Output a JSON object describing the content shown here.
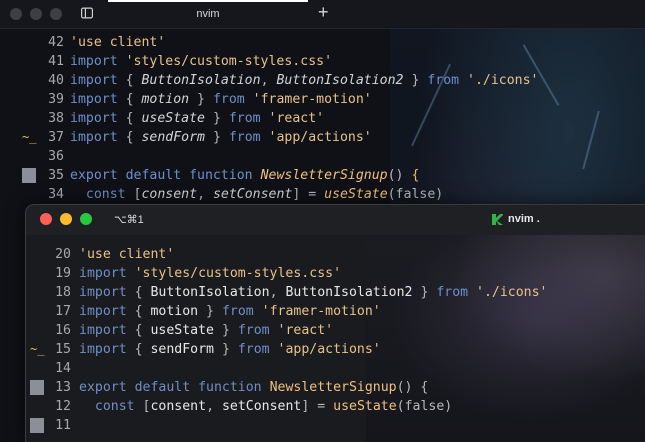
{
  "back_window": {
    "tab_label": "nvim",
    "lines": [
      {
        "num": "42",
        "gutter": "",
        "segments": [
          [
            "str",
            "'use client'"
          ]
        ]
      },
      {
        "num": "41",
        "gutter": "",
        "segments": [
          [
            "kw",
            "import "
          ],
          [
            "str",
            "'styles/custom-styles.css'"
          ]
        ]
      },
      {
        "num": "40",
        "gutter": "",
        "segments": [
          [
            "kw",
            "import "
          ],
          [
            "pun",
            "{ "
          ],
          [
            "id it",
            "ButtonIsolation"
          ],
          [
            "pun",
            ", "
          ],
          [
            "id it",
            "ButtonIsolation2"
          ],
          [
            "pun",
            " } "
          ],
          [
            "kw",
            "from "
          ],
          [
            "str",
            "'./icons'"
          ]
        ]
      },
      {
        "num": "39",
        "gutter": "",
        "segments": [
          [
            "kw",
            "import "
          ],
          [
            "pun",
            "{ "
          ],
          [
            "id it",
            "motion"
          ],
          [
            "pun",
            " } "
          ],
          [
            "kw",
            "from "
          ],
          [
            "str",
            "'framer-motion'"
          ]
        ]
      },
      {
        "num": "38",
        "gutter": "",
        "segments": [
          [
            "kw",
            "import "
          ],
          [
            "pun",
            "{ "
          ],
          [
            "id it",
            "useState"
          ],
          [
            "pun",
            " } "
          ],
          [
            "kw",
            "from "
          ],
          [
            "str",
            "'react'"
          ]
        ]
      },
      {
        "num": "37",
        "gutter": "~_",
        "segments": [
          [
            "kw",
            "import "
          ],
          [
            "pun",
            "{ "
          ],
          [
            "id it",
            "sendForm"
          ],
          [
            "pun",
            " } "
          ],
          [
            "kw",
            "from "
          ],
          [
            "str",
            "'app/actions'"
          ]
        ]
      },
      {
        "num": "36",
        "gutter": "",
        "segments": []
      },
      {
        "num": "35",
        "gutter": "block",
        "segments": [
          [
            "kw",
            "export default function "
          ],
          [
            "fn it",
            "NewsletterSignup"
          ],
          [
            "pun",
            "() "
          ],
          [
            "brk",
            "{"
          ]
        ]
      },
      {
        "num": "34",
        "gutter": "",
        "segments": [
          [
            "kw",
            "  const "
          ],
          [
            "pun",
            "["
          ],
          [
            "id it",
            "consent"
          ],
          [
            "pun",
            ", "
          ],
          [
            "id it",
            "setConsent"
          ],
          [
            "pun",
            "] = "
          ],
          [
            "fn it",
            "useState"
          ],
          [
            "pun",
            "(false)"
          ]
        ]
      }
    ]
  },
  "front_window": {
    "shortcut_label": "⌥⌘1",
    "title": "nvim .",
    "lines": [
      {
        "num": "20",
        "gutter": "",
        "segments": [
          [
            "str",
            "'use client'"
          ]
        ]
      },
      {
        "num": "19",
        "gutter": "",
        "segments": [
          [
            "kw",
            "import "
          ],
          [
            "str",
            "'styles/custom-styles.css'"
          ]
        ]
      },
      {
        "num": "18",
        "gutter": "",
        "segments": [
          [
            "kw",
            "import "
          ],
          [
            "pun",
            "{ "
          ],
          [
            "id",
            "ButtonIsolation"
          ],
          [
            "pun",
            ", "
          ],
          [
            "id",
            "ButtonIsolation2"
          ],
          [
            "pun",
            " } "
          ],
          [
            "kw",
            "from "
          ],
          [
            "str",
            "'./icons'"
          ]
        ]
      },
      {
        "num": "17",
        "gutter": "",
        "segments": [
          [
            "kw",
            "import "
          ],
          [
            "pun",
            "{ "
          ],
          [
            "id",
            "motion"
          ],
          [
            "pun",
            " } "
          ],
          [
            "kw",
            "from "
          ],
          [
            "str",
            "'framer-motion'"
          ]
        ]
      },
      {
        "num": "16",
        "gutter": "",
        "segments": [
          [
            "kw",
            "import "
          ],
          [
            "pun",
            "{ "
          ],
          [
            "id",
            "useState"
          ],
          [
            "pun",
            " } "
          ],
          [
            "kw",
            "from "
          ],
          [
            "str",
            "'react'"
          ]
        ]
      },
      {
        "num": "15",
        "gutter": "~_",
        "segments": [
          [
            "kw",
            "import "
          ],
          [
            "pun",
            "{ "
          ],
          [
            "id",
            "sendForm"
          ],
          [
            "pun",
            " } "
          ],
          [
            "kw",
            "from "
          ],
          [
            "str",
            "'app/actions'"
          ]
        ]
      },
      {
        "num": "14",
        "gutter": "",
        "segments": []
      },
      {
        "num": "13",
        "gutter": "block",
        "segments": [
          [
            "kw",
            "export default function "
          ],
          [
            "fn",
            "NewsletterSignup"
          ],
          [
            "pun",
            "() {"
          ]
        ]
      },
      {
        "num": "12",
        "gutter": "",
        "segments": [
          [
            "kw",
            "  const "
          ],
          [
            "pun",
            "["
          ],
          [
            "id",
            "consent"
          ],
          [
            "pun",
            ", "
          ],
          [
            "id",
            "setConsent"
          ],
          [
            "pun",
            "] = "
          ],
          [
            "fn",
            "useState"
          ],
          [
            "pun",
            "(false)"
          ]
        ]
      },
      {
        "num": "11",
        "gutter": "block",
        "segments": []
      }
    ]
  },
  "colors": {
    "keyword": "#6e8fc9",
    "string": "#e8c28a",
    "identifier": "#d4d4d4",
    "function": "#f0c080",
    "active_tab": "#ffffff"
  },
  "icons": [
    "sidebar-icon",
    "plus-icon",
    "vim-icon"
  ]
}
